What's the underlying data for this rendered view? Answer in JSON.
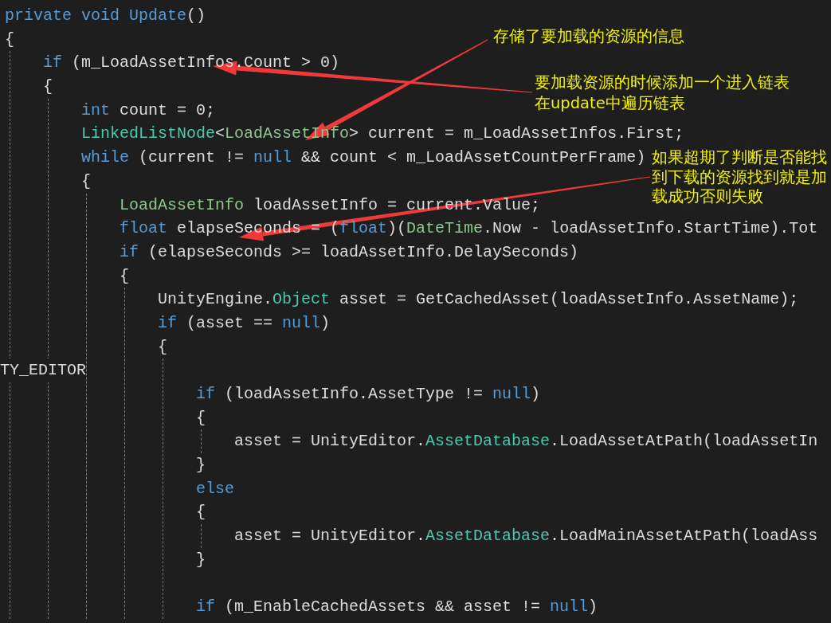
{
  "editor": {
    "lines": [
      {
        "kind": "code",
        "tokens": [
          {
            "text": "private void Update",
            "kind": "keyword"
          },
          {
            "text": "()",
            "kind": "plain"
          }
        ]
      },
      {
        "kind": "code",
        "tokens": [
          {
            "text": "{",
            "kind": "plain"
          }
        ],
        "children": [
          {
            "kind": "code",
            "tokens": [
              {
                "text": "if",
                "kind": "keyword"
              },
              {
                "text": " (m_LoadAssetInfos.Count > 0)",
                "kind": "plain"
              }
            ]
          },
          {
            "kind": "code",
            "tokens": [
              {
                "text": "{",
                "kind": "plain"
              }
            ],
            "children": [
              {
                "kind": "code",
                "tokens": [
                  {
                    "text": "int",
                    "kind": "keyword"
                  },
                  {
                    "text": " count = 0;",
                    "kind": "plain"
                  }
                ]
              },
              {
                "kind": "code",
                "tokens": [
                  {
                    "text": "LinkedListNode",
                    "kind": "class"
                  },
                  {
                    "text": "<",
                    "kind": "plain"
                  },
                  {
                    "text": "LoadAssetInfo",
                    "kind": "struct"
                  },
                  {
                    "text": "> current = m_LoadAssetInfos.First;",
                    "kind": "plain"
                  }
                ]
              },
              {
                "kind": "code",
                "tokens": [
                  {
                    "text": "while",
                    "kind": "keyword"
                  },
                  {
                    "text": " (current != ",
                    "kind": "plain"
                  },
                  {
                    "text": "null",
                    "kind": "keyword"
                  },
                  {
                    "text": " && count < m_LoadAssetCountPerFrame)",
                    "kind": "plain"
                  }
                ]
              },
              {
                "kind": "code",
                "tokens": [
                  {
                    "text": "{",
                    "kind": "plain"
                  }
                ],
                "children": [
                  {
                    "kind": "code",
                    "tokens": [
                      {
                        "text": "LoadAssetInfo",
                        "kind": "struct"
                      },
                      {
                        "text": " loadAssetInfo = current.Value;",
                        "kind": "plain"
                      }
                    ]
                  },
                  {
                    "kind": "code",
                    "tokens": [
                      {
                        "text": "float",
                        "kind": "keyword"
                      },
                      {
                        "text": " elapseSeconds = (",
                        "kind": "plain"
                      },
                      {
                        "text": "float",
                        "kind": "keyword"
                      },
                      {
                        "text": ")(",
                        "kind": "plain"
                      },
                      {
                        "text": "DateTime",
                        "kind": "struct"
                      },
                      {
                        "text": ".Now - loadAssetInfo.StartTime).Tot",
                        "kind": "plain"
                      }
                    ]
                  },
                  {
                    "kind": "code",
                    "tokens": [
                      {
                        "text": "if",
                        "kind": "keyword"
                      },
                      {
                        "text": " (elapseSeconds >= loadAssetInfo.DelaySeconds)",
                        "kind": "plain"
                      }
                    ]
                  },
                  {
                    "kind": "code",
                    "tokens": [
                      {
                        "text": "{",
                        "kind": "plain"
                      }
                    ],
                    "children": [
                      {
                        "kind": "code",
                        "tokens": [
                          {
                            "text": "UnityEngine.",
                            "kind": "plain"
                          },
                          {
                            "text": "Object",
                            "kind": "class"
                          },
                          {
                            "text": " asset = GetCachedAsset(loadAssetInfo.AssetName);",
                            "kind": "plain"
                          }
                        ]
                      },
                      {
                        "kind": "code",
                        "tokens": [
                          {
                            "text": "if",
                            "kind": "keyword"
                          },
                          {
                            "text": " (asset == ",
                            "kind": "plain"
                          },
                          {
                            "text": "null",
                            "kind": "keyword"
                          },
                          {
                            "text": ")",
                            "kind": "plain"
                          }
                        ]
                      },
                      {
                        "kind": "code",
                        "tokens": [
                          {
                            "text": "{",
                            "kind": "plain"
                          }
                        ],
                        "children": [
                          {
                            "kind": "directive",
                            "tokens": [
                              {
                                "text": "TY_EDITOR",
                                "kind": "plain"
                              }
                            ]
                          },
                          {
                            "kind": "code",
                            "tokens": [
                              {
                                "text": "if",
                                "kind": "keyword"
                              },
                              {
                                "text": " (loadAssetInfo.AssetType != ",
                                "kind": "plain"
                              },
                              {
                                "text": "null",
                                "kind": "keyword"
                              },
                              {
                                "text": ")",
                                "kind": "plain"
                              }
                            ]
                          },
                          {
                            "kind": "code",
                            "tokens": [
                              {
                                "text": "{",
                                "kind": "plain"
                              }
                            ],
                            "children": [
                              {
                                "kind": "code",
                                "tokens": [
                                  {
                                    "text": "asset = UnityEditor.",
                                    "kind": "plain"
                                  },
                                  {
                                    "text": "AssetDatabase",
                                    "kind": "class"
                                  },
                                  {
                                    "text": ".LoadAssetAtPath(loadAssetIn",
                                    "kind": "plain"
                                  }
                                ]
                              }
                            ]
                          },
                          {
                            "kind": "code",
                            "tokens": [
                              {
                                "text": "}",
                                "kind": "plain"
                              }
                            ]
                          },
                          {
                            "kind": "code",
                            "tokens": [
                              {
                                "text": "else",
                                "kind": "keyword"
                              }
                            ]
                          },
                          {
                            "kind": "code",
                            "tokens": [
                              {
                                "text": "{",
                                "kind": "plain"
                              }
                            ],
                            "children": [
                              {
                                "kind": "code",
                                "tokens": [
                                  {
                                    "text": "asset = UnityEditor.",
                                    "kind": "plain"
                                  },
                                  {
                                    "text": "AssetDatabase",
                                    "kind": "class"
                                  },
                                  {
                                    "text": ".LoadMainAssetAtPath(loadAss",
                                    "kind": "plain"
                                  }
                                ]
                              }
                            ]
                          },
                          {
                            "kind": "code",
                            "tokens": [
                              {
                                "text": "}",
                                "kind": "plain"
                              }
                            ]
                          },
                          {
                            "kind": "blank"
                          },
                          {
                            "kind": "code",
                            "tokens": [
                              {
                                "text": "if",
                                "kind": "keyword"
                              },
                              {
                                "text": " (m_EnableCachedAssets && asset != ",
                                "kind": "plain"
                              },
                              {
                                "text": "null",
                                "kind": "keyword"
                              },
                              {
                                "text": ")",
                                "kind": "plain"
                              }
                            ]
                          }
                        ]
                      }
                    ]
                  }
                ]
              }
            ]
          }
        ]
      }
    ]
  },
  "annotations": [
    {
      "lines": [
        "存储了要加载的资源的信息"
      ]
    },
    {
      "lines": [
        "要加载资源的时候添加一个进入链表",
        "在update中遍历链表"
      ]
    },
    {
      "lines": [
        "如果超期了判断是否能找到下载的资源找到就是加载成功否则失败"
      ]
    }
  ]
}
